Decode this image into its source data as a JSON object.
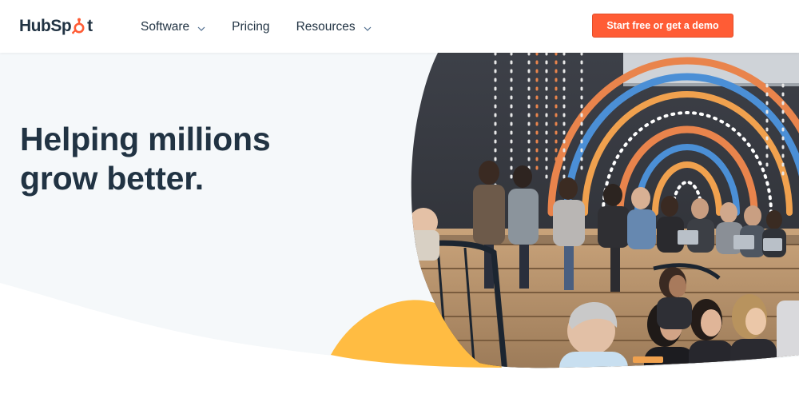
{
  "brand": {
    "logo_left": "HubSp",
    "logo_right": "t",
    "accent_color": "#ff5c35",
    "text_color": "#213343",
    "hero_bg_color": "#f5f8fa",
    "yellow_blob_color": "#ffbc42"
  },
  "nav": {
    "items": [
      {
        "label": "Software",
        "has_dropdown": true
      },
      {
        "label": "Pricing",
        "has_dropdown": false
      },
      {
        "label": "Resources",
        "has_dropdown": true
      }
    ]
  },
  "cta": {
    "label": "Start free or get a demo"
  },
  "hero": {
    "title_line_1": "Helping millions",
    "title_line_2": "grow better."
  },
  "icons": {
    "logo_sprocket": "hubspot-sprocket-icon",
    "dropdown": "chevron-down-icon"
  }
}
